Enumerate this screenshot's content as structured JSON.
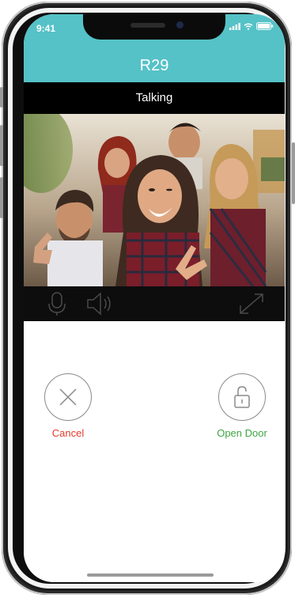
{
  "status_bar": {
    "time": "9:41"
  },
  "header": {
    "title": "R29"
  },
  "call": {
    "status": "Talking"
  },
  "controls": {
    "mic_icon": "microphone-icon",
    "speaker_icon": "speaker-icon",
    "expand_icon": "expand-icon"
  },
  "actions": {
    "cancel_label": "Cancel",
    "open_label": "Open Door"
  },
  "colors": {
    "header": "#55c2c7",
    "cancel": "#e33b2c",
    "open": "#3ea444"
  }
}
